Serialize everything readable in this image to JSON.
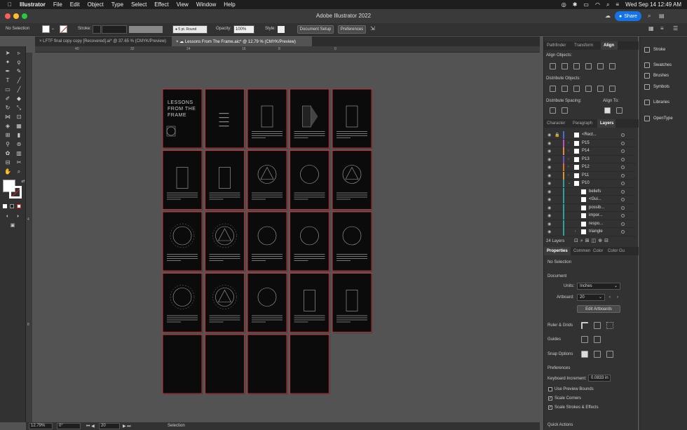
{
  "menubar": {
    "app": "Illustrator",
    "items": [
      "File",
      "Edit",
      "Object",
      "Type",
      "Select",
      "Effect",
      "View",
      "Window",
      "Help"
    ],
    "datetime": "Wed Sep 14  12:49 AM"
  },
  "titlebar": {
    "title": "Adobe Illustrator 2022",
    "share_label": "Share"
  },
  "control_bar": {
    "selection": "No Selection",
    "stroke_label": "Stroke:",
    "brush": "5 pt. Round",
    "opacity_label": "Opacity:",
    "opacity_value": "100%",
    "style_label": "Style:",
    "document_setup": "Document Setup",
    "preferences": "Preferences"
  },
  "tabs": [
    {
      "label": "LFTF final copy copy [Recovered].ai* @ 37.65 % (CMYK/Preview)",
      "active": false
    },
    {
      "label": "Lessons From The Frame.aic* @ 12.79 % (CMYK/Preview)",
      "active": true
    }
  ],
  "ruler": {
    "top": [
      "40",
      "32",
      "24",
      "16",
      "8",
      "0"
    ],
    "left": [
      "4",
      "8"
    ]
  },
  "artboard_cover": {
    "title_line1": "LESSONS",
    "title_line2": "FROM THE",
    "title_line3": "FRAME"
  },
  "status": {
    "zoom": "12.79%",
    "rotation": "0°",
    "artboard": "20",
    "tool": "Selection"
  },
  "panel_top": {
    "tabs": [
      "Pathfinder",
      "Transform",
      "Align"
    ],
    "align_objects": "Align Objects:",
    "distribute_objects": "Distribute Objects:",
    "distribute_spacing": "Distribute Spacing:",
    "align_to": "Align To:"
  },
  "panel_layers": {
    "tabs": [
      "Character",
      "Paragraph",
      "Layers"
    ],
    "layers": [
      {
        "name": "<Rect...",
        "color": "#4a6cd4",
        "arrow": "",
        "locked": true
      },
      {
        "name": "P15",
        "color": "#c050c0",
        "arrow": "›",
        "locked": false
      },
      {
        "name": "P14",
        "color": "#e09030",
        "arrow": "›",
        "locked": false
      },
      {
        "name": "P13",
        "color": "#7050d0",
        "arrow": "›",
        "locked": false
      },
      {
        "name": "P12",
        "color": "#e07030",
        "arrow": "›",
        "locked": false
      },
      {
        "name": "P11",
        "color": "#e09030",
        "arrow": "›",
        "locked": false
      },
      {
        "name": "P10",
        "color": "#30a0a0",
        "arrow": "⌄",
        "locked": false
      },
      {
        "name": "beliefs",
        "color": "#30a0a0",
        "arrow": "",
        "locked": false
      },
      {
        "name": "<Gui...",
        "color": "#30a0a0",
        "arrow": "",
        "locked": false
      },
      {
        "name": "possib...",
        "color": "#30a0a0",
        "arrow": "",
        "locked": false
      },
      {
        "name": "impor...",
        "color": "#30a0a0",
        "arrow": "",
        "locked": false
      },
      {
        "name": "respo...",
        "color": "#30a0a0",
        "arrow": "",
        "locked": false
      },
      {
        "name": "triangle",
        "color": "#30a0a0",
        "arrow": "›",
        "locked": false
      }
    ],
    "count": "24 Layers"
  },
  "panel_properties": {
    "tabs": [
      "Properties",
      "Commen",
      "Color",
      "Color Gu"
    ],
    "no_selection": "No Selection",
    "document": "Document",
    "units_label": "Units:",
    "units_value": "Inches",
    "artboard_label": "Artboard:",
    "artboard_value": "20",
    "edit_artboards": "Edit Artboards",
    "ruler_grids": "Ruler & Grids",
    "guides": "Guides",
    "snap_options": "Snap Options",
    "preferences": "Preferences",
    "keyboard_increment_label": "Keyboard Increment:",
    "keyboard_increment_value": "0.0833 in",
    "use_preview_bounds": "Use Preview Bounds",
    "scale_corners": "Scale Corners",
    "scale_strokes": "Scale Strokes & Effects",
    "quick_actions": "Quick Actions"
  },
  "dock": {
    "items": [
      "Stroke",
      "Swatches",
      "Brushes",
      "Symbols",
      "Libraries",
      "OpenType"
    ]
  }
}
